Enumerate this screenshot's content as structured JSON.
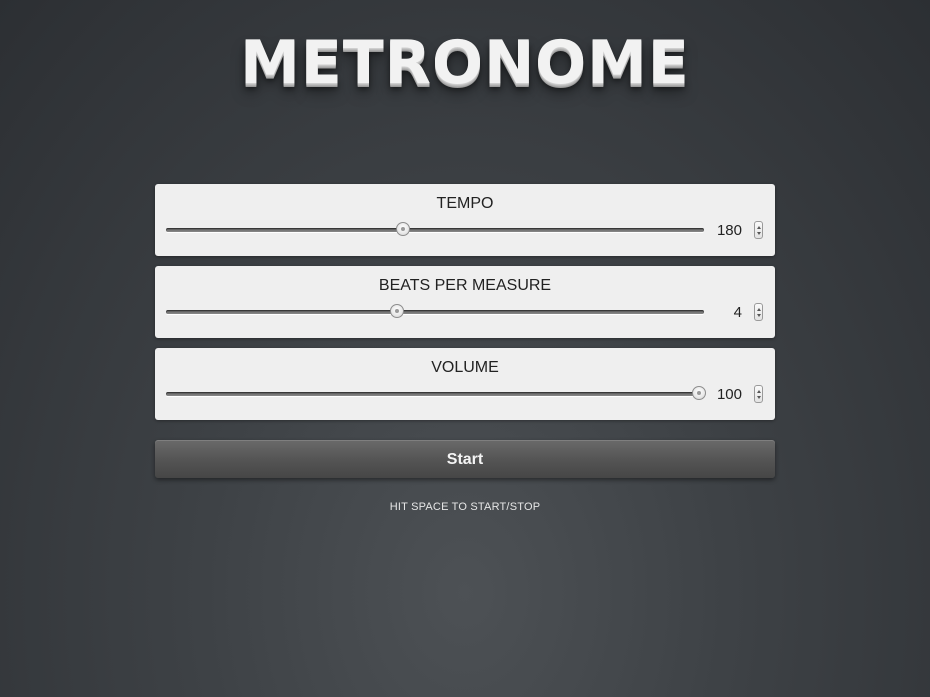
{
  "app": {
    "title": "METRONOME"
  },
  "controls": [
    {
      "label": "TEMPO",
      "value": "180",
      "slider_fraction": 0.44
    },
    {
      "label": "BEATS PER MEASURE",
      "value": "4",
      "slider_fraction": 0.43
    },
    {
      "label": "VOLUME",
      "value": "100",
      "slider_fraction": 0.99
    }
  ],
  "start_button": {
    "label": "Start"
  },
  "hint": {
    "text": "HIT SPACE TO START/STOP"
  },
  "colors": {
    "panel_bg": "#efefef",
    "background": "#3e4246",
    "button_bg": "#555555"
  },
  "icons": {
    "spinner": "up-down-arrows-icon",
    "slider_thumb": "circle-knob-icon"
  }
}
